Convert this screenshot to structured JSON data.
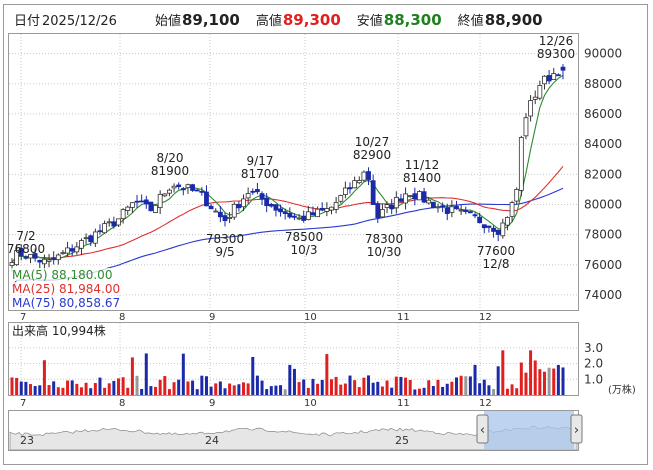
{
  "header": {
    "date_label": "日付",
    "date": "2025/12/26",
    "open_label": "始値",
    "open": "89,100",
    "high_label": "高値",
    "high": "89,300",
    "low_label": "安値",
    "low": "88,300",
    "close_label": "終値",
    "close": "88,900"
  },
  "colors": {
    "up": "#e02020",
    "down": "#1a2aa8",
    "ma5": "#2e8b2e",
    "ma25": "#e03030",
    "ma75": "#2a3ad0",
    "grid": "#c8c8c8",
    "low_val": "#208020"
  },
  "legend": [
    {
      "name": "MA(5)",
      "value": "88,180.00"
    },
    {
      "name": "MA(25)",
      "value": "81,984.00"
    },
    {
      "name": "MA(75)",
      "value": "80,858.67"
    }
  ],
  "volume_label": "出来高",
  "volume_value": "10,994株",
  "volume_unit": "(万株)",
  "chart_data": {
    "type": "candlestick",
    "x_axis_months": [
      "7",
      "8",
      "9",
      "10",
      "11",
      "12"
    ],
    "price_ylim": [
      73000,
      91300
    ],
    "price_ticks": [
      74000,
      76000,
      78000,
      80000,
      82000,
      84000,
      86000,
      88000,
      90000
    ],
    "volume_ticks": [
      "1.0",
      "2.0",
      "3.0"
    ],
    "annotations": [
      {
        "lines": [
          "7/2",
          "76800"
        ]
      },
      {
        "lines": [
          "8/20",
          "81900"
        ]
      },
      {
        "lines": [
          "9/17",
          "81700"
        ]
      },
      {
        "lines": [
          "10/27",
          "82900"
        ]
      },
      {
        "lines": [
          "11/12",
          "81400"
        ]
      },
      {
        "lines": [
          "12/26",
          "89300"
        ]
      },
      {
        "lines": [
          "78300",
          "9/5"
        ]
      },
      {
        "lines": [
          "78500",
          "10/3"
        ]
      },
      {
        "lines": [
          "78300",
          "10/30"
        ]
      },
      {
        "lines": [
          "77600",
          "12/8"
        ]
      }
    ],
    "ohlc_anchors": [
      {
        "date": "7/1",
        "close": 76500
      },
      {
        "date": "7/2",
        "close": 76800,
        "high": 76800
      },
      {
        "date": "7/15",
        "close": 76100
      },
      {
        "date": "7/25",
        "close": 77400
      },
      {
        "date": "8/1",
        "close": 79000
      },
      {
        "date": "8/6",
        "close": 80200
      },
      {
        "date": "8/12",
        "close": 79600
      },
      {
        "date": "8/20",
        "close": 81400,
        "high": 81900
      },
      {
        "date": "8/29",
        "close": 80700
      },
      {
        "date": "9/5",
        "close": 78900,
        "low": 78300
      },
      {
        "date": "9/17",
        "close": 80900,
        "high": 81700
      },
      {
        "date": "9/26",
        "close": 79800
      },
      {
        "date": "10/3",
        "close": 79000,
        "low": 78500
      },
      {
        "date": "10/15",
        "close": 79700
      },
      {
        "date": "10/27",
        "close": 82300,
        "high": 82900
      },
      {
        "date": "10/30",
        "close": 79100,
        "low": 78300
      },
      {
        "date": "11/12",
        "close": 80900,
        "high": 81400
      },
      {
        "date": "11/20",
        "close": 79800
      },
      {
        "date": "12/1",
        "close": 79000
      },
      {
        "date": "12/8",
        "close": 78300,
        "low": 77600
      },
      {
        "date": "12/15",
        "close": 80500
      },
      {
        "date": "12/17",
        "close": 85500
      },
      {
        "date": "12/22",
        "close": 88000
      },
      {
        "date": "12/26",
        "close": 88900,
        "open": 89100,
        "high": 89300,
        "low": 88300
      }
    ]
  },
  "navigator_labels": [
    "23",
    "24",
    "25"
  ]
}
